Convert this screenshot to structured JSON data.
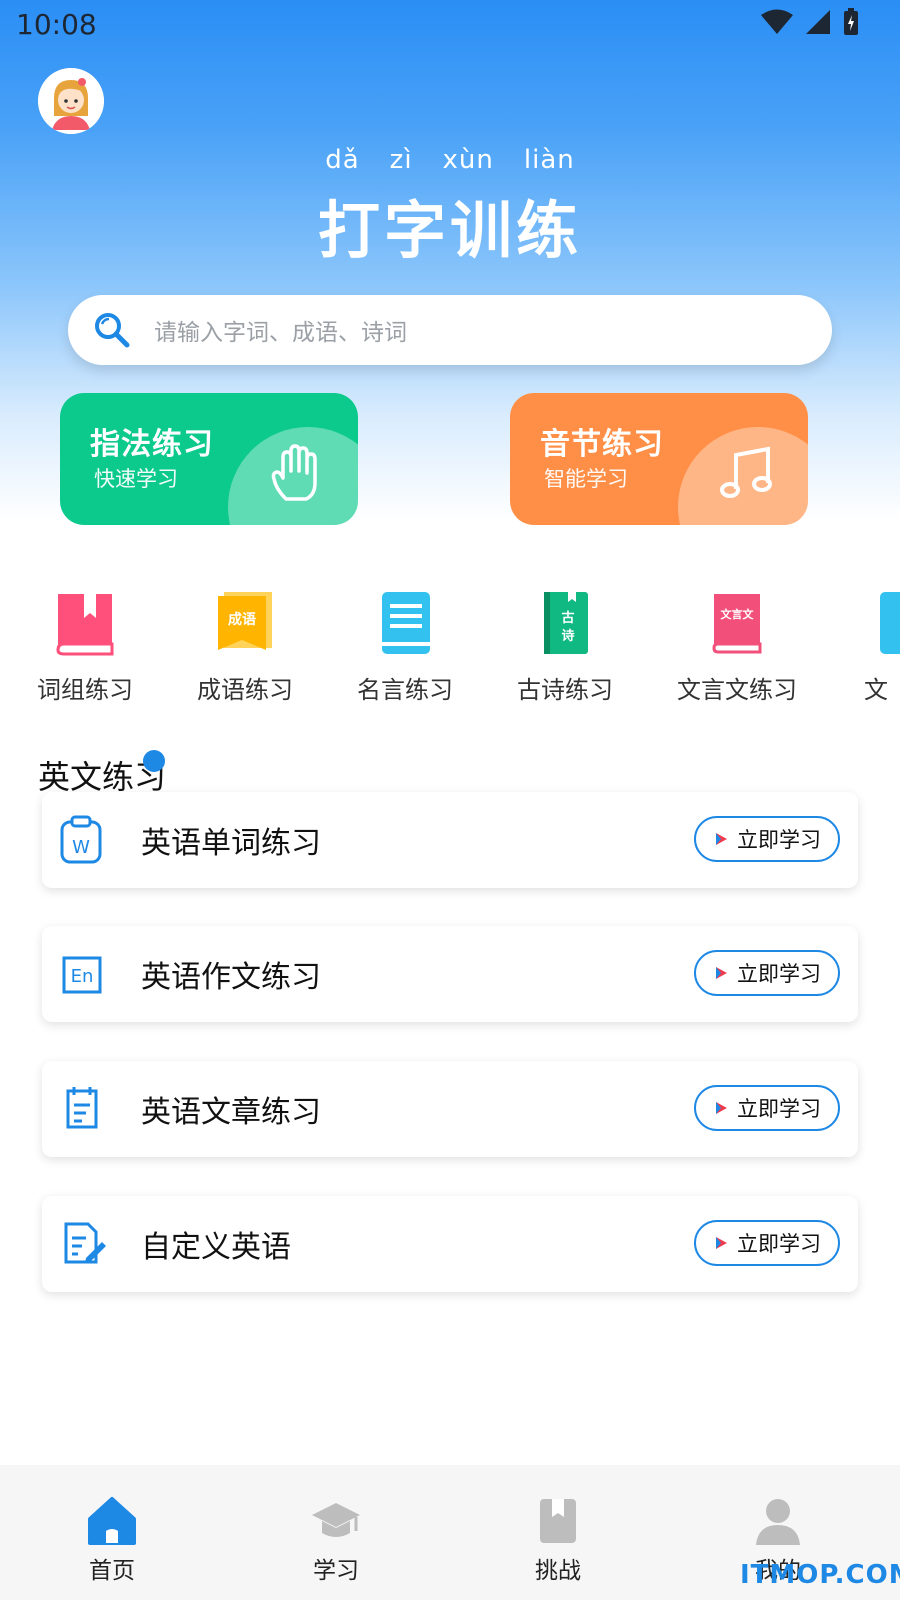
{
  "status": {
    "time": "10:08"
  },
  "header": {
    "pinyin": [
      "dǎ",
      "zì",
      "xùn",
      "liàn"
    ],
    "title": "打字训练"
  },
  "search": {
    "placeholder": "请输入字词、成语、诗词",
    "icon": "search-icon"
  },
  "cards": [
    {
      "title": "指法练习",
      "subtitle": "快速学习",
      "icon": "hand-icon",
      "color": "#0cc98c"
    },
    {
      "title": "音节练习",
      "subtitle": "智能学习",
      "icon": "music-note-icon",
      "color": "#ff8f47"
    }
  ],
  "categories": [
    {
      "label": "词组练习",
      "icon": "book-icon",
      "color": "#ff4f7b"
    },
    {
      "label": "成语练习",
      "icon": "idiom-book-icon",
      "color": "#ffb400",
      "badge": "成语"
    },
    {
      "label": "名言练习",
      "icon": "quote-book-icon",
      "color": "#33c2f0"
    },
    {
      "label": "古诗练习",
      "icon": "poem-book-icon",
      "color": "#10b981",
      "badge": "古诗"
    },
    {
      "label": "文言文练习",
      "icon": "classical-book-icon",
      "color": "#f2507a",
      "badge": "文言文"
    },
    {
      "label": "文",
      "icon": "partial-book-icon",
      "color": "#33c2f0"
    }
  ],
  "english": {
    "section_title": "英文练习",
    "action_label": "立即学习",
    "items": [
      {
        "label": "英语单词练习",
        "icon": "word-icon"
      },
      {
        "label": "英语作文练习",
        "icon": "en-icon"
      },
      {
        "label": "英语文章练习",
        "icon": "article-icon"
      },
      {
        "label": "自定义英语",
        "icon": "edit-document-icon"
      }
    ]
  },
  "nav": [
    {
      "label": "首页",
      "icon": "home-icon",
      "active": true
    },
    {
      "label": "学习",
      "icon": "graduation-cap-icon",
      "active": false
    },
    {
      "label": "挑战",
      "icon": "bookmark-icon",
      "active": false
    },
    {
      "label": "我的",
      "icon": "person-icon",
      "active": false
    }
  ],
  "watermark": "ITMOP.COM",
  "colors": {
    "primary": "#1e88e5",
    "header_top": "#2a8ef5"
  }
}
